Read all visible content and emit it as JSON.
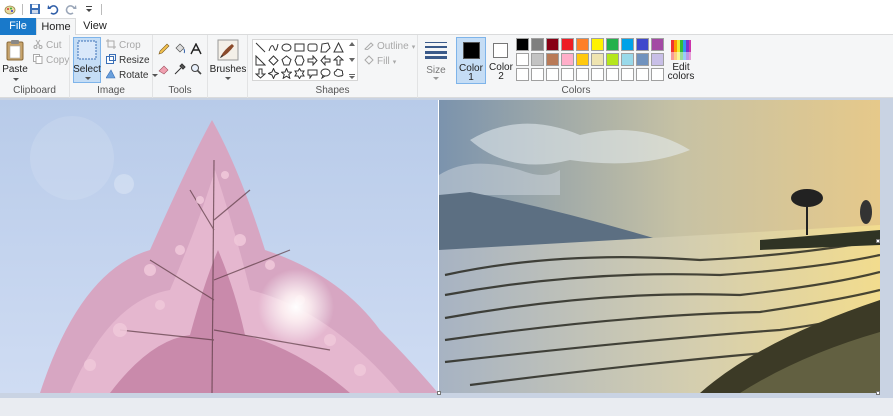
{
  "tabs": {
    "file": "File",
    "home": "Home",
    "view": "View"
  },
  "clipboard": {
    "paste": "Paste",
    "cut": "Cut",
    "copy": "Copy",
    "label": "Clipboard"
  },
  "image": {
    "select": "Select",
    "crop": "Crop",
    "resize": "Resize",
    "rotate": "Rotate",
    "label": "Image"
  },
  "tools": {
    "label": "Tools"
  },
  "brushes": {
    "label": "Brushes"
  },
  "shapes": {
    "outline": "Outline",
    "fill": "Fill",
    "label": "Shapes"
  },
  "size": {
    "label": "Size"
  },
  "colors": {
    "color1_line1": "Color",
    "color1_line2": "1",
    "color2_line1": "Color",
    "color2_line2": "2",
    "edit_line1": "Edit",
    "edit_line2": "colors",
    "label": "Colors",
    "color1_value": "#000000",
    "color2_value": "#ffffff",
    "palette_row1": [
      "#000000",
      "#7f7f7f",
      "#880015",
      "#ed1c24",
      "#ff7f27",
      "#fff200",
      "#22b14c",
      "#00a2e8",
      "#3f48cc",
      "#a349a4"
    ],
    "palette_row2": [
      "#ffffff",
      "#c3c3c3",
      "#b97a57",
      "#ffaec9",
      "#ffc90e",
      "#efe4b0",
      "#b5e61d",
      "#99d9ea",
      "#7092be",
      "#c8bfe7"
    ]
  }
}
